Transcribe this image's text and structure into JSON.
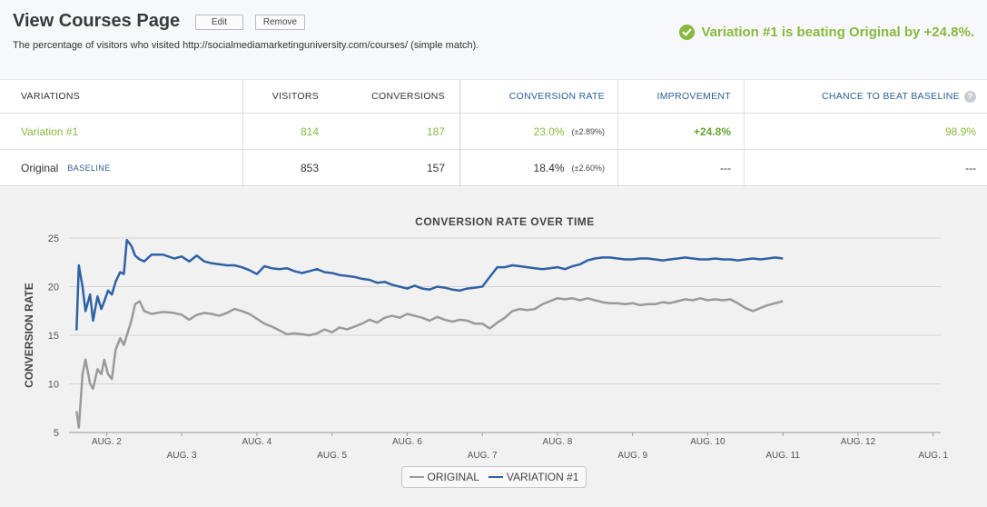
{
  "header": {
    "title": "View Courses Page",
    "edit_label": "Edit",
    "remove_label": "Remove",
    "description": "The percentage of visitors who visited http://socialmediamarketinguniversity.com/courses/ (simple match).",
    "winner_text": "Variation #1 is beating Original by +24.8%."
  },
  "table": {
    "headers": {
      "variations": "VARIATIONS",
      "visitors": "VISITORS",
      "conversions": "CONVERSIONS",
      "conversion_rate": "CONVERSION RATE",
      "improvement": "IMPROVEMENT",
      "chance": "CHANCE TO BEAT BASELINE"
    },
    "rows": [
      {
        "name": "Variation #1",
        "tag": "",
        "visitors": "814",
        "conversions": "187",
        "rate": "23.0%",
        "rate_err": "(±2.89%)",
        "improvement": "+24.8%",
        "chance": "98.9%"
      },
      {
        "name": "Original",
        "tag": "BASELINE",
        "visitors": "853",
        "conversions": "157",
        "rate": "18.4%",
        "rate_err": "(±2.60%)",
        "improvement": "---",
        "chance": "---"
      }
    ]
  },
  "colors": {
    "green": "#8ab93e",
    "blue": "#2e62a5",
    "gray": "#9a9a9a"
  },
  "icons": {
    "winner": "check-circle-icon",
    "help": "question-circle-icon"
  },
  "chart_data": {
    "type": "line",
    "title": "CONVERSION RATE OVER TIME",
    "ylabel": "CONVERSION RATE",
    "xlabel": "",
    "ylim": [
      5,
      25
    ],
    "yticks": [
      5,
      10,
      15,
      20,
      25
    ],
    "xlim": [
      1.5,
      13.1
    ],
    "xticks": [
      {
        "x": 2,
        "label": "AUG. 2",
        "row": 0
      },
      {
        "x": 3,
        "label": "AUG. 3",
        "row": 1
      },
      {
        "x": 4,
        "label": "AUG. 4",
        "row": 0
      },
      {
        "x": 5,
        "label": "AUG. 5",
        "row": 1
      },
      {
        "x": 6,
        "label": "AUG. 6",
        "row": 0
      },
      {
        "x": 7,
        "label": "AUG. 7",
        "row": 1
      },
      {
        "x": 8,
        "label": "AUG. 8",
        "row": 0
      },
      {
        "x": 9,
        "label": "AUG. 9",
        "row": 1
      },
      {
        "x": 10,
        "label": "AUG. 10",
        "row": 0
      },
      {
        "x": 11,
        "label": "AUG. 11",
        "row": 1
      },
      {
        "x": 12,
        "label": "AUG. 12",
        "row": 0
      },
      {
        "x": 13,
        "label": "AUG. 1",
        "row": 1
      }
    ],
    "grid": true,
    "legend": "bottom-center",
    "series": [
      {
        "name": "ORIGINAL",
        "color": "#9a9a9a",
        "points": [
          [
            1.6,
            7.2
          ],
          [
            1.63,
            5.5
          ],
          [
            1.68,
            11
          ],
          [
            1.72,
            12.5
          ],
          [
            1.78,
            10
          ],
          [
            1.82,
            9.5
          ],
          [
            1.88,
            11.5
          ],
          [
            1.93,
            11
          ],
          [
            1.97,
            12.5
          ],
          [
            2.02,
            11
          ],
          [
            2.07,
            10.5
          ],
          [
            2.12,
            13.5
          ],
          [
            2.18,
            14.7
          ],
          [
            2.23,
            14
          ],
          [
            2.27,
            15
          ],
          [
            2.33,
            16.5
          ],
          [
            2.38,
            18.2
          ],
          [
            2.44,
            18.5
          ],
          [
            2.5,
            17.5
          ],
          [
            2.6,
            17.2
          ],
          [
            2.75,
            17.4
          ],
          [
            2.9,
            17.3
          ],
          [
            3.0,
            17.1
          ],
          [
            3.1,
            16.6
          ],
          [
            3.2,
            17.1
          ],
          [
            3.3,
            17.3
          ],
          [
            3.4,
            17.2
          ],
          [
            3.5,
            17.0
          ],
          [
            3.6,
            17.3
          ],
          [
            3.7,
            17.7
          ],
          [
            3.8,
            17.5
          ],
          [
            3.9,
            17.2
          ],
          [
            4.0,
            16.7
          ],
          [
            4.1,
            16.2
          ],
          [
            4.2,
            15.9
          ],
          [
            4.3,
            15.5
          ],
          [
            4.4,
            15.1
          ],
          [
            4.5,
            15.2
          ],
          [
            4.6,
            15.1
          ],
          [
            4.7,
            15.0
          ],
          [
            4.8,
            15.2
          ],
          [
            4.9,
            15.6
          ],
          [
            5.0,
            15.3
          ],
          [
            5.1,
            15.8
          ],
          [
            5.2,
            15.6
          ],
          [
            5.3,
            15.9
          ],
          [
            5.4,
            16.2
          ],
          [
            5.5,
            16.6
          ],
          [
            5.6,
            16.3
          ],
          [
            5.7,
            16.8
          ],
          [
            5.8,
            17.0
          ],
          [
            5.9,
            16.8
          ],
          [
            6.0,
            17.2
          ],
          [
            6.1,
            17.0
          ],
          [
            6.2,
            16.8
          ],
          [
            6.3,
            16.5
          ],
          [
            6.4,
            16.9
          ],
          [
            6.5,
            16.6
          ],
          [
            6.6,
            16.4
          ],
          [
            6.7,
            16.6
          ],
          [
            6.8,
            16.5
          ],
          [
            6.9,
            16.2
          ],
          [
            7.0,
            16.2
          ],
          [
            7.1,
            15.7
          ],
          [
            7.2,
            16.3
          ],
          [
            7.3,
            16.8
          ],
          [
            7.4,
            17.5
          ],
          [
            7.5,
            17.7
          ],
          [
            7.6,
            17.6
          ],
          [
            7.7,
            17.7
          ],
          [
            7.8,
            18.2
          ],
          [
            7.9,
            18.5
          ],
          [
            8.0,
            18.8
          ],
          [
            8.1,
            18.7
          ],
          [
            8.2,
            18.8
          ],
          [
            8.3,
            18.6
          ],
          [
            8.4,
            18.8
          ],
          [
            8.5,
            18.6
          ],
          [
            8.6,
            18.4
          ],
          [
            8.7,
            18.3
          ],
          [
            8.8,
            18.3
          ],
          [
            8.9,
            18.2
          ],
          [
            9.0,
            18.3
          ],
          [
            9.1,
            18.1
          ],
          [
            9.2,
            18.2
          ],
          [
            9.3,
            18.2
          ],
          [
            9.4,
            18.4
          ],
          [
            9.5,
            18.3
          ],
          [
            9.6,
            18.5
          ],
          [
            9.7,
            18.7
          ],
          [
            9.8,
            18.6
          ],
          [
            9.9,
            18.8
          ],
          [
            10.0,
            18.6
          ],
          [
            10.1,
            18.7
          ],
          [
            10.2,
            18.6
          ],
          [
            10.3,
            18.7
          ],
          [
            10.4,
            18.3
          ],
          [
            10.5,
            17.8
          ],
          [
            10.6,
            17.5
          ],
          [
            10.7,
            17.8
          ],
          [
            10.8,
            18.1
          ],
          [
            10.9,
            18.3
          ],
          [
            11.0,
            18.5
          ]
        ]
      },
      {
        "name": "VARIATION #1",
        "color": "#2e62a5",
        "points": [
          [
            1.6,
            15.5
          ],
          [
            1.63,
            22.2
          ],
          [
            1.68,
            20
          ],
          [
            1.72,
            17.5
          ],
          [
            1.78,
            19.2
          ],
          [
            1.82,
            16.5
          ],
          [
            1.88,
            19
          ],
          [
            1.93,
            17.7
          ],
          [
            1.97,
            18.5
          ],
          [
            2.02,
            19.6
          ],
          [
            2.07,
            19.2
          ],
          [
            2.12,
            20.5
          ],
          [
            2.18,
            21.5
          ],
          [
            2.23,
            21.3
          ],
          [
            2.27,
            24.8
          ],
          [
            2.33,
            24.2
          ],
          [
            2.38,
            23.2
          ],
          [
            2.44,
            22.8
          ],
          [
            2.5,
            22.6
          ],
          [
            2.6,
            23.3
          ],
          [
            2.75,
            23.3
          ],
          [
            2.9,
            22.9
          ],
          [
            3.0,
            23.1
          ],
          [
            3.1,
            22.6
          ],
          [
            3.2,
            23.2
          ],
          [
            3.3,
            22.6
          ],
          [
            3.4,
            22.4
          ],
          [
            3.5,
            22.3
          ],
          [
            3.6,
            22.2
          ],
          [
            3.7,
            22.2
          ],
          [
            3.8,
            22.0
          ],
          [
            3.9,
            21.7
          ],
          [
            4.0,
            21.3
          ],
          [
            4.1,
            22.1
          ],
          [
            4.2,
            21.9
          ],
          [
            4.3,
            21.8
          ],
          [
            4.4,
            21.9
          ],
          [
            4.5,
            21.6
          ],
          [
            4.6,
            21.4
          ],
          [
            4.7,
            21.6
          ],
          [
            4.8,
            21.8
          ],
          [
            4.9,
            21.5
          ],
          [
            5.0,
            21.4
          ],
          [
            5.1,
            21.2
          ],
          [
            5.2,
            21.1
          ],
          [
            5.3,
            21.0
          ],
          [
            5.4,
            20.8
          ],
          [
            5.5,
            20.7
          ],
          [
            5.6,
            20.4
          ],
          [
            5.7,
            20.5
          ],
          [
            5.8,
            20.2
          ],
          [
            5.9,
            20.0
          ],
          [
            6.0,
            19.8
          ],
          [
            6.1,
            20.1
          ],
          [
            6.2,
            19.8
          ],
          [
            6.3,
            19.7
          ],
          [
            6.4,
            20.0
          ],
          [
            6.5,
            19.9
          ],
          [
            6.6,
            19.7
          ],
          [
            6.7,
            19.6
          ],
          [
            6.8,
            19.8
          ],
          [
            6.9,
            19.9
          ],
          [
            7.0,
            20.0
          ],
          [
            7.1,
            21.0
          ],
          [
            7.2,
            22.0
          ],
          [
            7.3,
            22.0
          ],
          [
            7.4,
            22.2
          ],
          [
            7.5,
            22.1
          ],
          [
            7.6,
            22.0
          ],
          [
            7.7,
            21.9
          ],
          [
            7.8,
            21.8
          ],
          [
            7.9,
            21.9
          ],
          [
            8.0,
            22.0
          ],
          [
            8.1,
            21.8
          ],
          [
            8.2,
            22.1
          ],
          [
            8.3,
            22.3
          ],
          [
            8.4,
            22.7
          ],
          [
            8.5,
            22.9
          ],
          [
            8.6,
            23.0
          ],
          [
            8.7,
            23.0
          ],
          [
            8.8,
            22.9
          ],
          [
            8.9,
            22.8
          ],
          [
            9.0,
            22.8
          ],
          [
            9.1,
            22.9
          ],
          [
            9.2,
            22.9
          ],
          [
            9.3,
            22.8
          ],
          [
            9.4,
            22.7
          ],
          [
            9.5,
            22.8
          ],
          [
            9.6,
            22.9
          ],
          [
            9.7,
            23.0
          ],
          [
            9.8,
            22.9
          ],
          [
            9.9,
            22.8
          ],
          [
            10.0,
            22.8
          ],
          [
            10.1,
            22.9
          ],
          [
            10.2,
            22.8
          ],
          [
            10.3,
            22.8
          ],
          [
            10.4,
            22.7
          ],
          [
            10.5,
            22.8
          ],
          [
            10.6,
            22.9
          ],
          [
            10.7,
            22.8
          ],
          [
            10.8,
            22.9
          ],
          [
            10.9,
            23.0
          ],
          [
            11.0,
            22.9
          ]
        ]
      }
    ]
  }
}
